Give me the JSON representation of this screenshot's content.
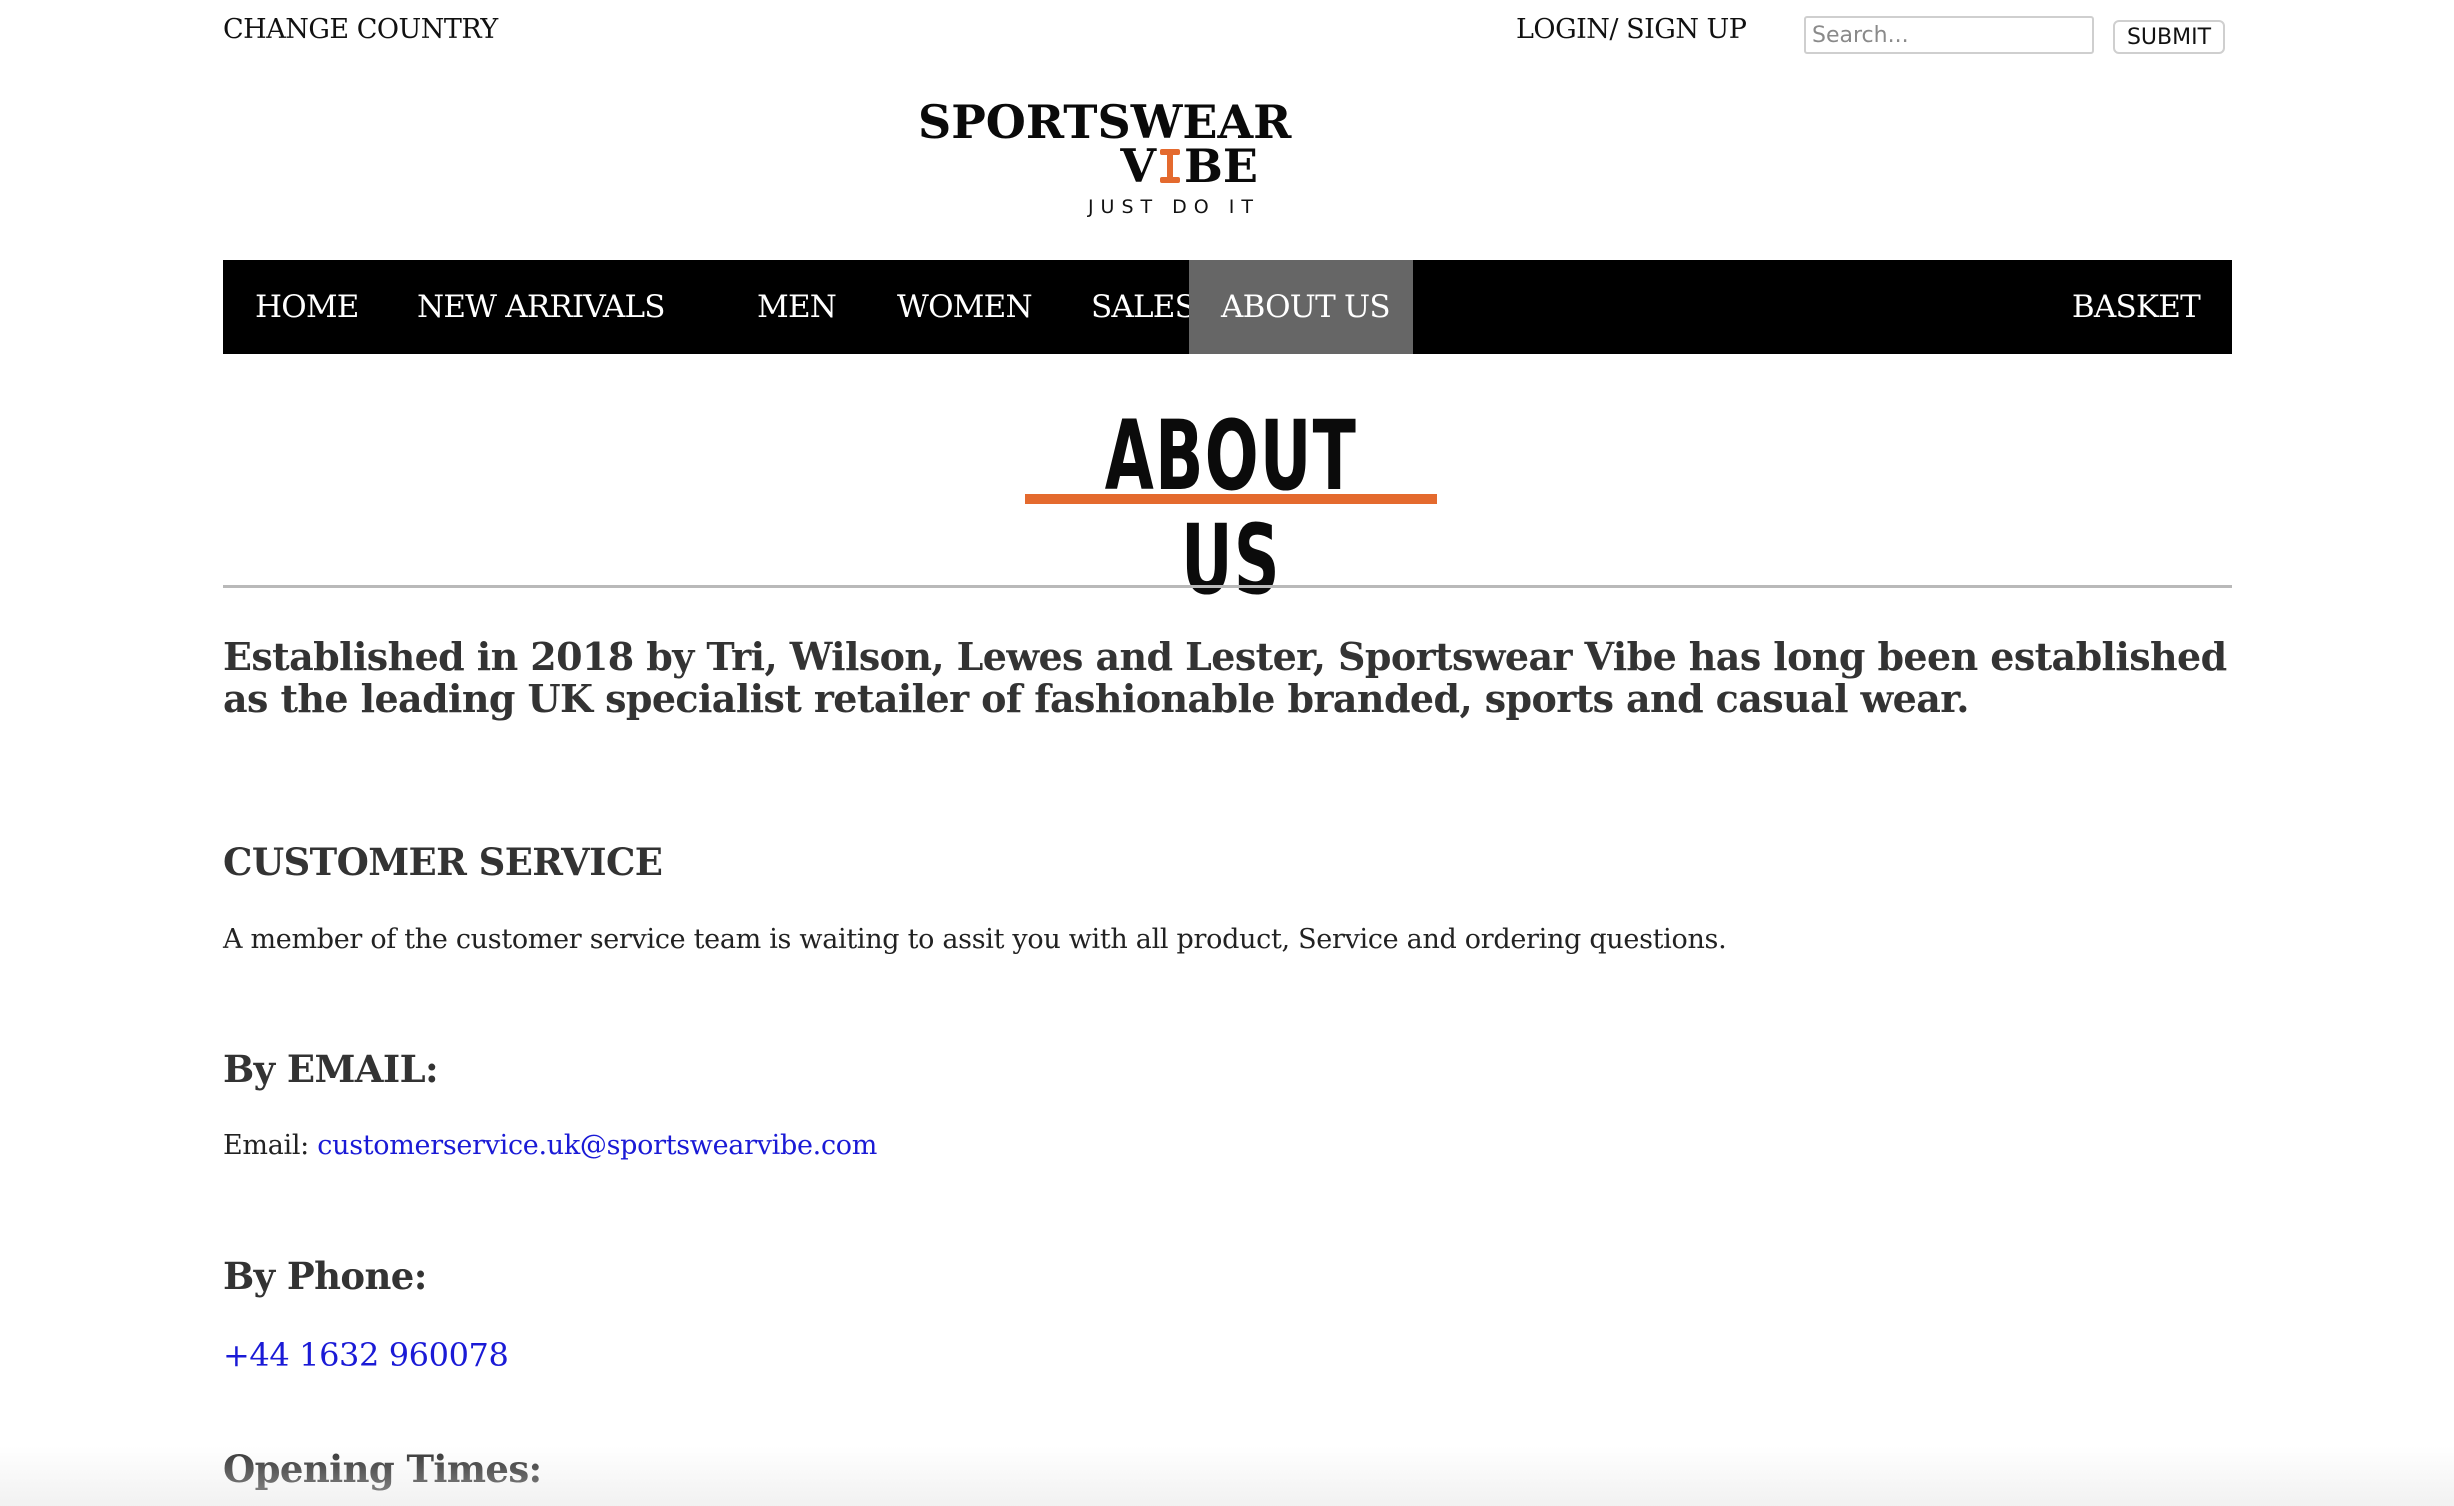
{
  "topbar": {
    "change_country": "CHANGE COUNTRY",
    "login": "LOGIN/ SIGN UP",
    "search_placeholder": "Search...",
    "submit_label": "SUBMIT"
  },
  "logo": {
    "line1": "SPORTSWEAR",
    "line2_start": "V",
    "line2_end": "BE",
    "tagline": "JUST DO IT",
    "accent_color": "#e46a2e",
    "icon": "dumbbell-icon"
  },
  "nav": {
    "items": [
      {
        "label": "HOME",
        "active": false
      },
      {
        "label": "NEW ARRIVALS",
        "active": false
      },
      {
        "label": "MEN",
        "active": false
      },
      {
        "label": "WOMEN",
        "active": false
      },
      {
        "label": "SALES",
        "active": false
      },
      {
        "label": "ABOUT US",
        "active": true
      }
    ],
    "basket": "BASKET",
    "background": "#000000",
    "active_background": "#666666"
  },
  "page": {
    "heading": "ABOUT US",
    "heading_underline_color": "#e46a2e",
    "intro": "Established in 2018 by Tri, Wilson, Lewes and Lester, Sportswear Vibe has long been established as the leading UK specialist retailer of fashionable branded, sports and casual wear."
  },
  "customer_service": {
    "title": "CUSTOMER SERVICE",
    "text": "A member of the customer service team is waiting to assit you with all product, Service and ordering questions."
  },
  "email_section": {
    "title": "By EMAIL:",
    "label": "Email:",
    "address": "customerservice.uk@sportswearvibe.com"
  },
  "phone_section": {
    "title": "By Phone:",
    "number": "+44 1632 960078"
  },
  "opening_section": {
    "title": "Opening Times:"
  },
  "colors": {
    "link": "#1a1ad6",
    "text": "#333333"
  }
}
